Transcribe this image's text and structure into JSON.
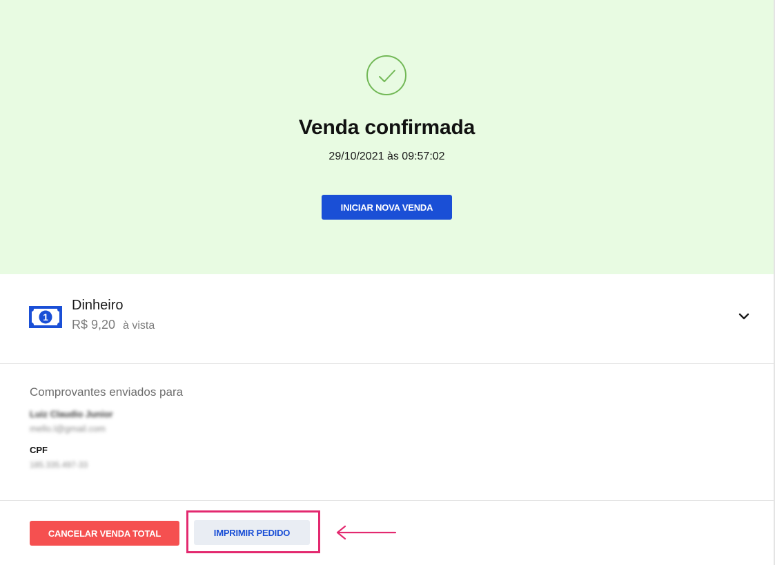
{
  "success": {
    "title": "Venda confirmada",
    "datetime": "29/10/2021 às 09:57:02",
    "new_sale_button": "INICIAR NOVA VENDA",
    "background_color": "#e8fbe2",
    "check_color": "#72b856",
    "icon": "check-circle-icon"
  },
  "payment": {
    "method": "Dinheiro",
    "amount": "R$ 9,20",
    "terms": "à vista",
    "icon": "cash-bill-icon",
    "expand_icon": "chevron-down-icon"
  },
  "receipts": {
    "title": "Comprovantes enviados para",
    "customer_name": "Luiz Claudio Junior",
    "customer_email": "mello.l@gmail.com",
    "cpf_label": "CPF",
    "cpf_value": "185.335.497-33"
  },
  "actions": {
    "cancel_button": "CANCELAR VENDA TOTAL",
    "print_button": "IMPRIMIR PEDIDO",
    "cancel_color": "#f55050",
    "primary_color": "#1a4fd6",
    "annotation_color": "#e3296f"
  }
}
